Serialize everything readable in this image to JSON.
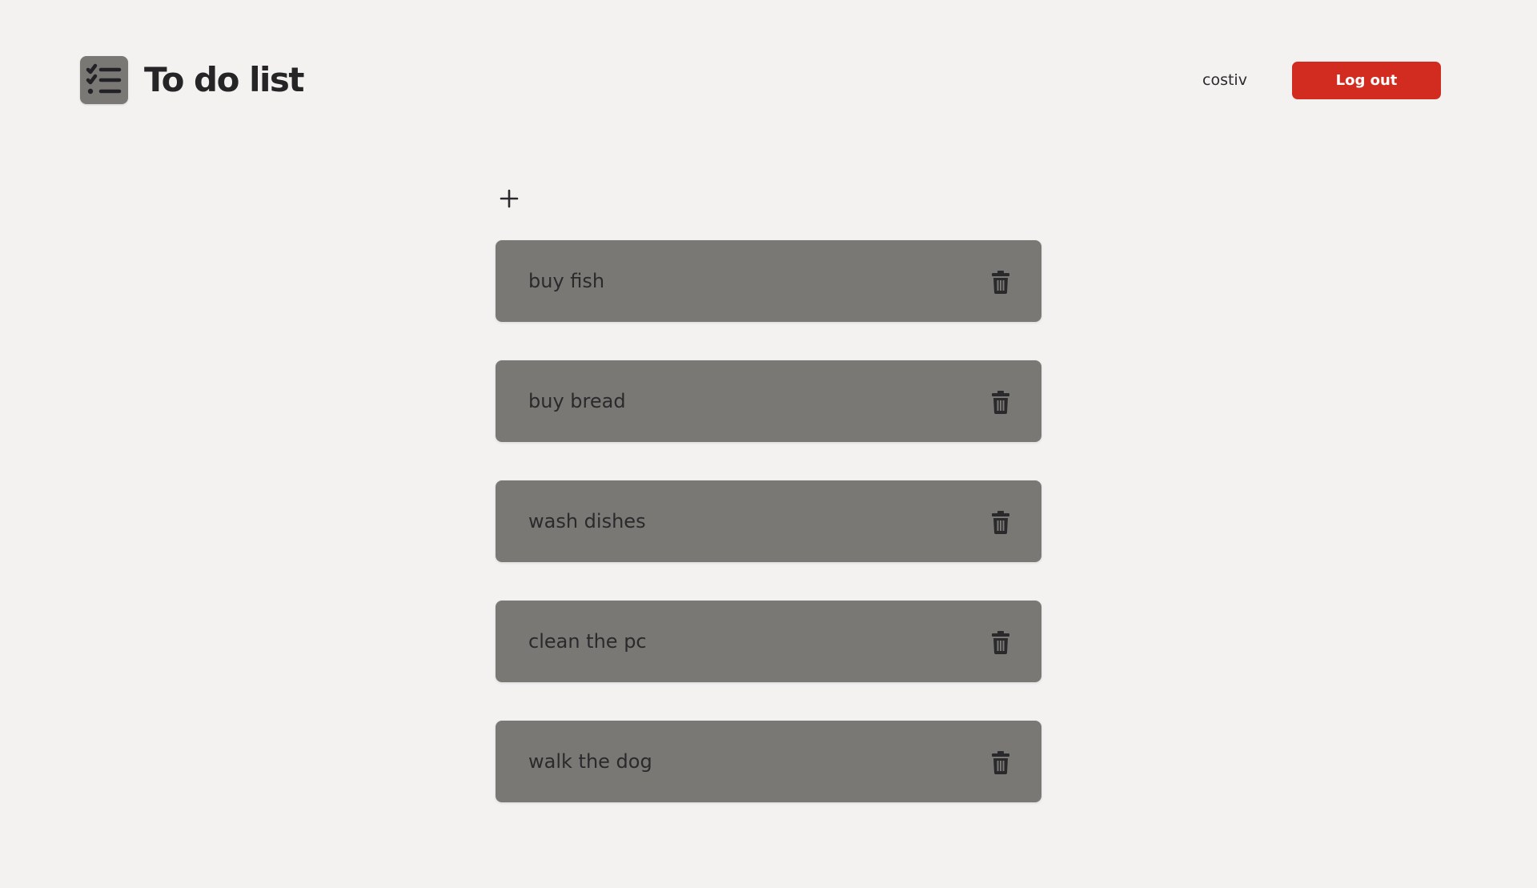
{
  "header": {
    "title": "To do list",
    "logo_icon": "checklist-icon",
    "username": "costiv",
    "logout_label": "Log out"
  },
  "toolbar": {
    "add_icon": "plus-icon"
  },
  "todos": [
    {
      "text": "buy fish",
      "delete_icon": "trash-icon"
    },
    {
      "text": "buy bread",
      "delete_icon": "trash-icon"
    },
    {
      "text": "wash dishes",
      "delete_icon": "trash-icon"
    },
    {
      "text": "clean the pc",
      "delete_icon": "trash-icon"
    },
    {
      "text": "walk the dog",
      "delete_icon": "trash-icon"
    }
  ],
  "colors": {
    "background": "#f3f2f1",
    "card": "#7a7874",
    "text": "#2a2a2c",
    "accent": "#d22b20"
  }
}
